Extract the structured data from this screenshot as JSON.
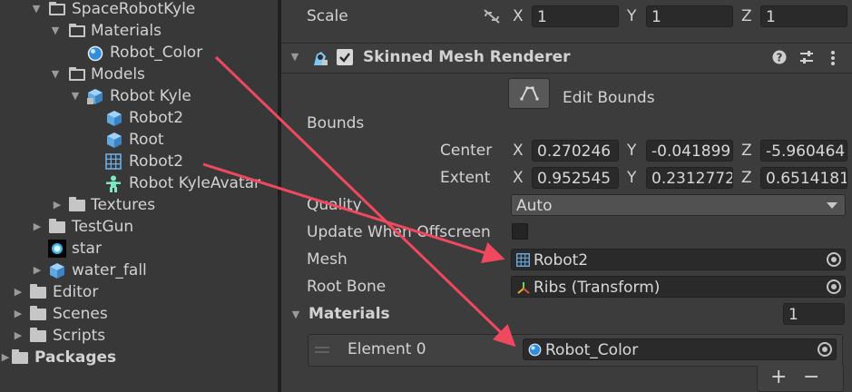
{
  "project": {
    "items": [
      {
        "label": "SpaceRobotKyle",
        "icon": "folder-open-icon",
        "expanded": true
      },
      {
        "label": "Materials",
        "icon": "folder-open-icon",
        "expanded": true
      },
      {
        "label": "Robot_Color",
        "icon": "material-sphere-icon"
      },
      {
        "label": "Models",
        "icon": "folder-open-icon",
        "expanded": true
      },
      {
        "label": "Robot Kyle",
        "icon": "model-prefab-icon",
        "expanded": true
      },
      {
        "label": "Robot2",
        "icon": "mesh-cube-icon"
      },
      {
        "label": "Root",
        "icon": "mesh-cube-icon"
      },
      {
        "label": "Robot2",
        "icon": "mesh-grid-icon"
      },
      {
        "label": "Robot KyleAvatar",
        "icon": "avatar-icon"
      },
      {
        "label": "Textures",
        "icon": "folder-closed-icon",
        "expanded": false
      },
      {
        "label": "TestGun",
        "icon": "folder-closed-icon",
        "expanded": false
      },
      {
        "label": "star",
        "icon": "star-texture-icon"
      },
      {
        "label": "water_fall",
        "icon": "prefab-cube-icon",
        "expanded": false
      },
      {
        "label": "Editor",
        "icon": "folder-closed-icon",
        "expanded": false
      },
      {
        "label": "Scenes",
        "icon": "folder-closed-icon",
        "expanded": false
      },
      {
        "label": "Scripts",
        "icon": "folder-closed-icon",
        "expanded": false
      },
      {
        "label": "Packages",
        "icon": "folder-closed-icon",
        "expanded": false
      }
    ]
  },
  "inspector": {
    "scale": {
      "label": "Scale",
      "x_axis": "X",
      "y_axis": "Y",
      "z_axis": "Z",
      "x": "1",
      "y": "1",
      "z": "1"
    },
    "component": {
      "title": "Skinned Mesh Renderer",
      "enabled": true
    },
    "edit_bounds": {
      "label": "Edit Bounds"
    },
    "bounds": {
      "label": "Bounds",
      "center": {
        "label": "Center",
        "x_axis": "X",
        "y_axis": "Y",
        "z_axis": "Z",
        "x": "0.270246",
        "y": "-0.041899",
        "z": "-5.960464"
      },
      "extent": {
        "label": "Extent",
        "x_axis": "X",
        "y_axis": "Y",
        "z_axis": "Z",
        "x": "0.952545",
        "y": "0.2312772",
        "z": "0.6514181"
      }
    },
    "quality": {
      "label": "Quality",
      "value": "Auto"
    },
    "update_offscreen": {
      "label": "Update When Offscreen",
      "checked": false
    },
    "mesh": {
      "label": "Mesh",
      "value": "Robot2"
    },
    "root_bone": {
      "label": "Root Bone",
      "value": "Ribs (Transform)"
    },
    "materials": {
      "label": "Materials",
      "count": "1",
      "element_label": "Element 0",
      "element_value": "Robot_Color",
      "add": "+",
      "remove": "−"
    }
  },
  "colors": {
    "arrow": "#f0485e",
    "accent_blue": "#4aa3ff"
  }
}
